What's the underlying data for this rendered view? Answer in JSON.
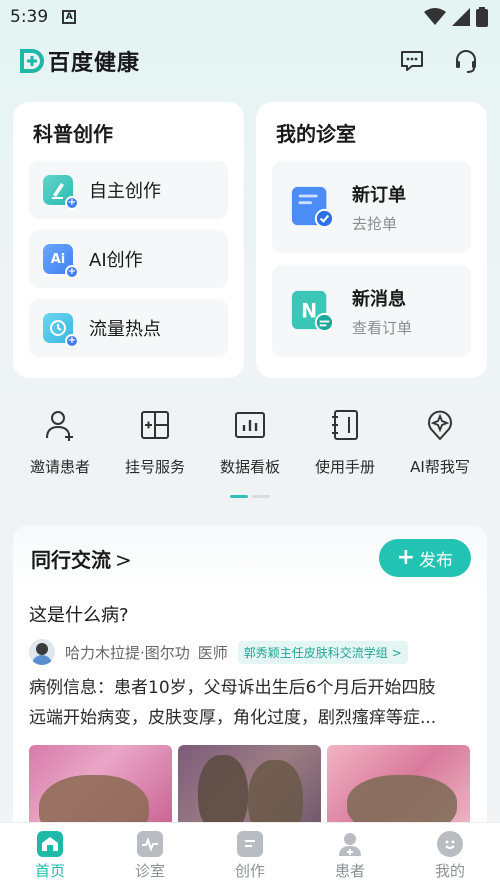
{
  "status_bar": {
    "time": "5:39",
    "notif_icon": "A"
  },
  "header": {
    "app_name": "百度健康",
    "message_icon": "message-icon",
    "service_icon": "headset-icon"
  },
  "science_card": {
    "title": "科普创作",
    "items": [
      {
        "label": "自主创作",
        "icon": "pen-icon"
      },
      {
        "label": "AI创作",
        "icon": "ai-icon"
      },
      {
        "label": "流量热点",
        "icon": "hotspot-icon"
      }
    ]
  },
  "clinic_card": {
    "title": "我的诊室",
    "items": [
      {
        "title": "新订单",
        "subtitle": "去抢单",
        "icon": "order-icon"
      },
      {
        "title": "新消息",
        "subtitle": "查看订单",
        "icon": "notes-icon"
      }
    ]
  },
  "tools": [
    {
      "label": "邀请患者",
      "icon": "invite-patient-icon"
    },
    {
      "label": "挂号服务",
      "icon": "registration-icon"
    },
    {
      "label": "数据看板",
      "icon": "dashboard-icon"
    },
    {
      "label": "使用手册",
      "icon": "manual-icon"
    },
    {
      "label": "AI帮我写",
      "icon": "ai-write-icon"
    }
  ],
  "feed": {
    "title": "同行交流",
    "publish_label": "发布",
    "post": {
      "title": "这是什么病?",
      "author": "哈力木拉提·图尔功",
      "role": "医师",
      "group": "郭秀颖主任皮肤科交流学组",
      "body_line1": "病例信息：患者10岁，父母诉出生后6个月后开始四肢",
      "body_line2": "远端开始病变，皮肤变厚，角化过度，剧烈瘙痒等症..."
    }
  },
  "bottom_nav": [
    {
      "label": "首页",
      "icon": "home-icon",
      "active": true
    },
    {
      "label": "诊室",
      "icon": "clinic-icon",
      "active": false
    },
    {
      "label": "创作",
      "icon": "create-icon",
      "active": false
    },
    {
      "label": "患者",
      "icon": "patient-icon",
      "active": false
    },
    {
      "label": "我的",
      "icon": "profile-icon",
      "active": false
    }
  ],
  "colors": {
    "accent": "#23c3b3",
    "blue": "#3d7ef5"
  }
}
